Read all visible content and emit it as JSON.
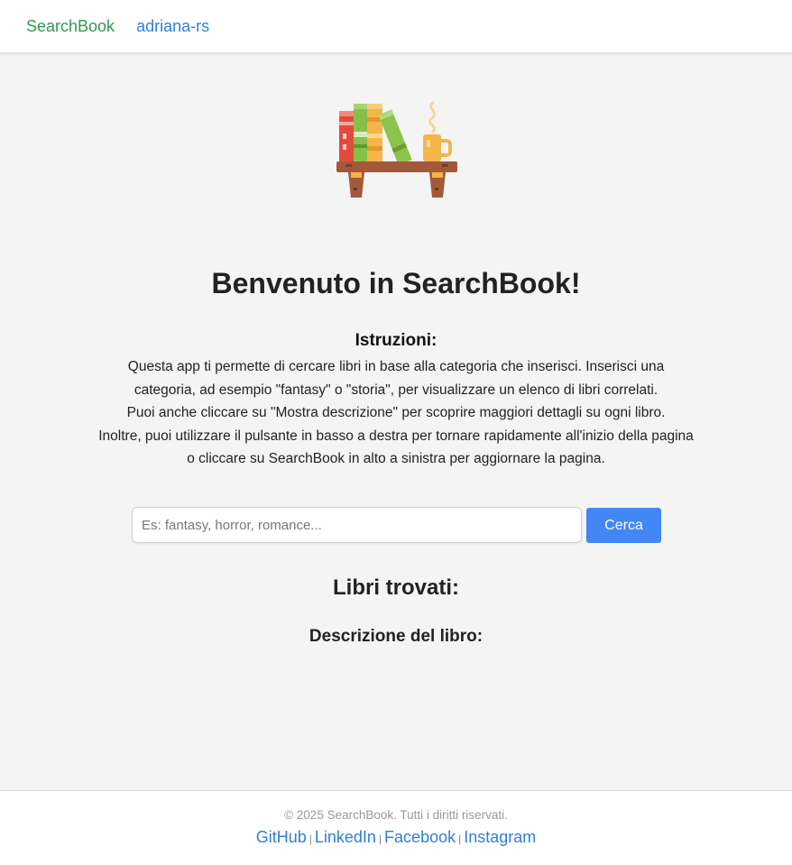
{
  "nav": {
    "brand": "SearchBook",
    "user": "adriana-rs"
  },
  "hero": {
    "icon": "bookshelf-with-books-and-coffee-icon"
  },
  "main": {
    "title": "Benvenuto in SearchBook!",
    "instructions_heading": "Istruzioni:",
    "instructions_lines": [
      "Questa app ti permette di cercare libri in base alla categoria che inserisci. Inserisci una",
      "categoria, ad esempio \"fantasy\" o \"storia\", per visualizzare un elenco di libri correlati.",
      "Puoi anche cliccare su \"Mostra descrizione\" per scoprire maggiori dettagli su ogni libro.",
      "Inoltre, puoi utilizzare il pulsante in basso a destra per tornare rapidamente all'inizio della pagina",
      "o cliccare su SearchBook in alto a sinistra per aggiornare la pagina."
    ],
    "search": {
      "placeholder": "Es: fantasy, horror, romance...",
      "value": "",
      "button_label": "Cerca"
    },
    "results_heading": "Libri trovati:",
    "description_heading": "Descrizione del libro:"
  },
  "footer": {
    "copyright": "© 2025 SearchBook. Tutti i diritti riservati.",
    "separator": "|",
    "links": [
      "GitHub",
      "LinkedIn",
      "Facebook",
      "Instagram"
    ]
  },
  "colors": {
    "brand": "#2e9a4a",
    "link": "#2f7fd8",
    "button": "#4287f5",
    "background": "#f4f4f4"
  }
}
